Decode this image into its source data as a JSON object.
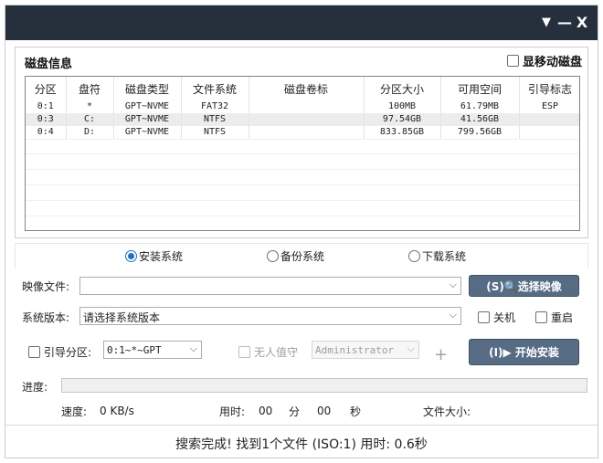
{
  "titlebar": {
    "menu_glyph": "▼",
    "min_glyph": "—",
    "close_glyph": "X"
  },
  "disk_info": {
    "title": "磁盘信息",
    "show_removable_label": "显移动磁盘",
    "show_removable_checked": false,
    "columns": [
      "分区",
      "盘符",
      "磁盘类型",
      "文件系统",
      "磁盘卷标",
      "分区大小",
      "可用空间",
      "引导标志"
    ],
    "rows": [
      {
        "partition": "0:1",
        "letter": "*",
        "type": "GPT~NVME",
        "fs": "FAT32",
        "label": "",
        "size": "100MB",
        "free": "61.79MB",
        "boot": "ESP",
        "selected": false
      },
      {
        "partition": "0:3",
        "letter": "C:",
        "type": "GPT~NVME",
        "fs": "NTFS",
        "label": "",
        "size": "97.54GB",
        "free": "41.56GB",
        "boot": "",
        "selected": true
      },
      {
        "partition": "0:4",
        "letter": "D:",
        "type": "GPT~NVME",
        "fs": "NTFS",
        "label": "",
        "size": "833.85GB",
        "free": "799.56GB",
        "boot": "",
        "selected": false
      }
    ]
  },
  "mode": {
    "options": [
      {
        "label": "安装系统",
        "selected": true
      },
      {
        "label": "备份系统",
        "selected": false
      },
      {
        "label": "下载系统",
        "selected": false
      }
    ]
  },
  "image_file": {
    "label": "映像文件:",
    "value": "",
    "choose_button": "(S)🔍选择映像"
  },
  "system_version": {
    "label": "系统版本:",
    "value": "请选择系统版本",
    "shutdown_label": "关机",
    "restart_label": "重启"
  },
  "boot": {
    "boot_partition_label": "引导分区:",
    "boot_partition_value": "0:1~*~GPT",
    "unattended_label": "无人值守",
    "user_value": "Administrator",
    "plus_glyph": "+",
    "start_button": "(I)▶ 开始安装"
  },
  "progress": {
    "label": "进度:",
    "value_percent": 0
  },
  "stats": {
    "speed_label": "速度:",
    "speed_value": "0 KB/s",
    "time_label": "用时:",
    "minutes": "00",
    "minutes_unit": "分",
    "seconds": "00",
    "seconds_unit": "秒",
    "file_size_label": "文件大小:"
  },
  "status": {
    "text": "搜索完成! 找到1个文件 (ISO:1) 用时: 0.6秒"
  },
  "colors": {
    "titlebar": "#26303d",
    "primary_button": "#566b84",
    "radio_selected": "#1a6fd3"
  }
}
